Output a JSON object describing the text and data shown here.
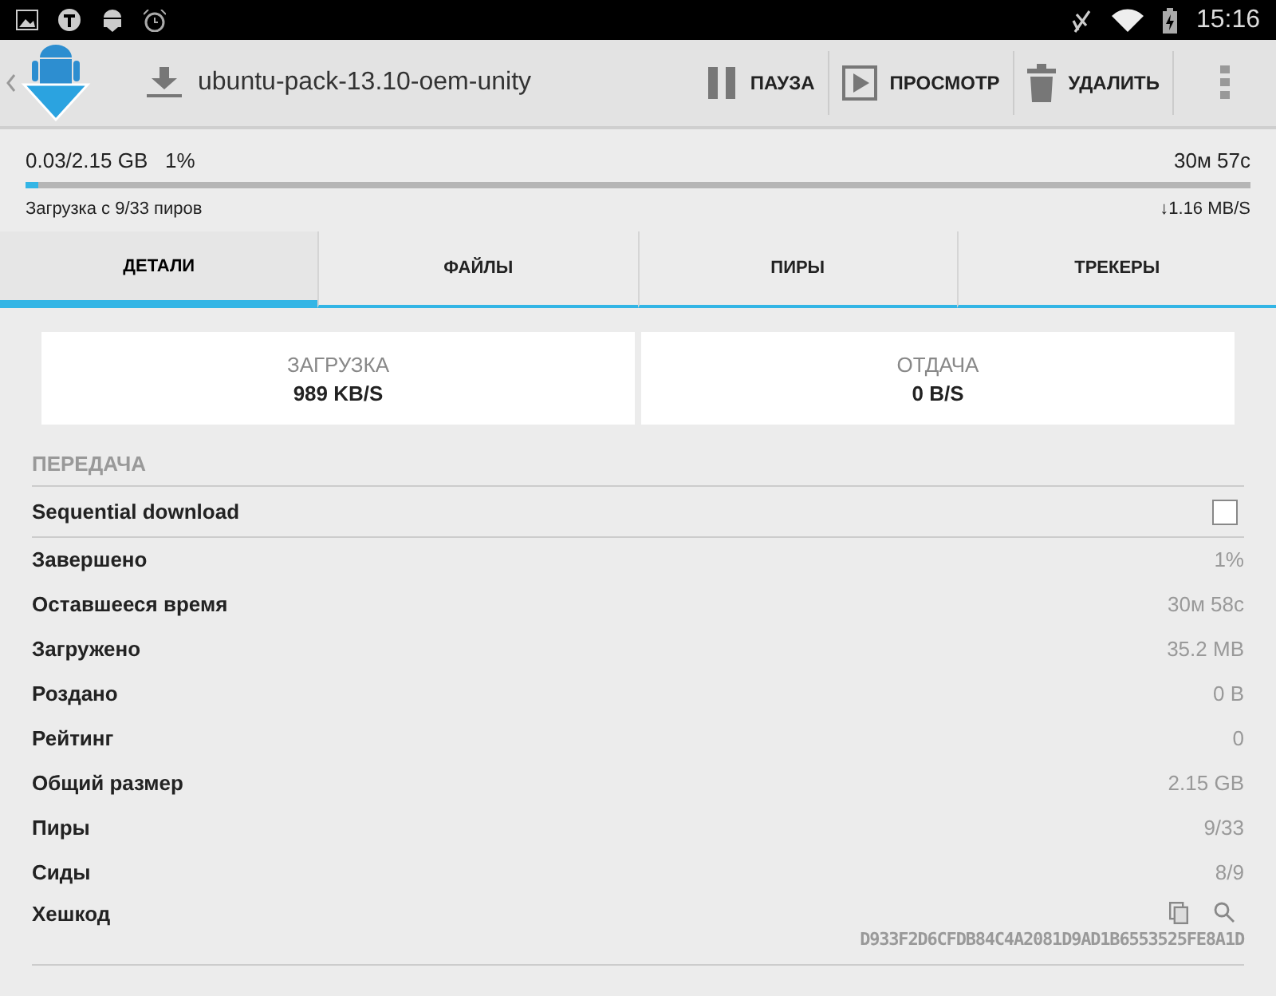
{
  "status_bar": {
    "time": "15:16"
  },
  "action_bar": {
    "title": "ubuntu-pack-13.10-oem-unity",
    "actions": [
      {
        "label": "ПАУЗА",
        "kind": "pause"
      },
      {
        "label": "ПРОСМОТР",
        "kind": "play"
      },
      {
        "label": "УДАЛИТЬ",
        "kind": "delete"
      }
    ]
  },
  "progress": {
    "size": "0.03/2.15 GB",
    "percent": "1%",
    "eta": "30м 57с",
    "level": 0.01,
    "peers": "Загрузка с 9/33 пиров",
    "speed": "↓1.16 MB/S"
  },
  "tabs": [
    {
      "label": "ДЕТАЛИ",
      "selected": true
    },
    {
      "label": "ФАЙЛЫ",
      "selected": false
    },
    {
      "label": "ПИРЫ",
      "selected": false
    },
    {
      "label": "ТРЕКЕРЫ",
      "selected": false
    }
  ],
  "stats": [
    {
      "label": "ЗАГРУЗКА",
      "value": "989 KB/S"
    },
    {
      "label": "ОТДАЧА",
      "value": "0 B/S"
    }
  ],
  "section": "ПЕРЕДАЧА",
  "rows": [
    {
      "kind": "checkbox",
      "label": "Sequential download",
      "checked": false
    },
    {
      "kind": "value",
      "label": "Завершено",
      "value": "1%"
    },
    {
      "kind": "value",
      "label": "Оставшееся время",
      "value": "30м 58с"
    },
    {
      "kind": "value",
      "label": "Загружено",
      "value": "35.2 MB"
    },
    {
      "kind": "value",
      "label": "Роздано",
      "value": "0 B"
    },
    {
      "kind": "value",
      "label": "Рейтинг",
      "value": "0"
    },
    {
      "kind": "value",
      "label": "Общий размер",
      "value": "2.15 GB"
    },
    {
      "kind": "value",
      "label": "Пиры",
      "value": "9/33"
    },
    {
      "kind": "value",
      "label": "Сиды",
      "value": "8/9"
    },
    {
      "kind": "hash",
      "label": "Хешкод",
      "value": "D933F2D6CFDB84C4A2081D9AD1B6553525FE8A1D"
    }
  ]
}
